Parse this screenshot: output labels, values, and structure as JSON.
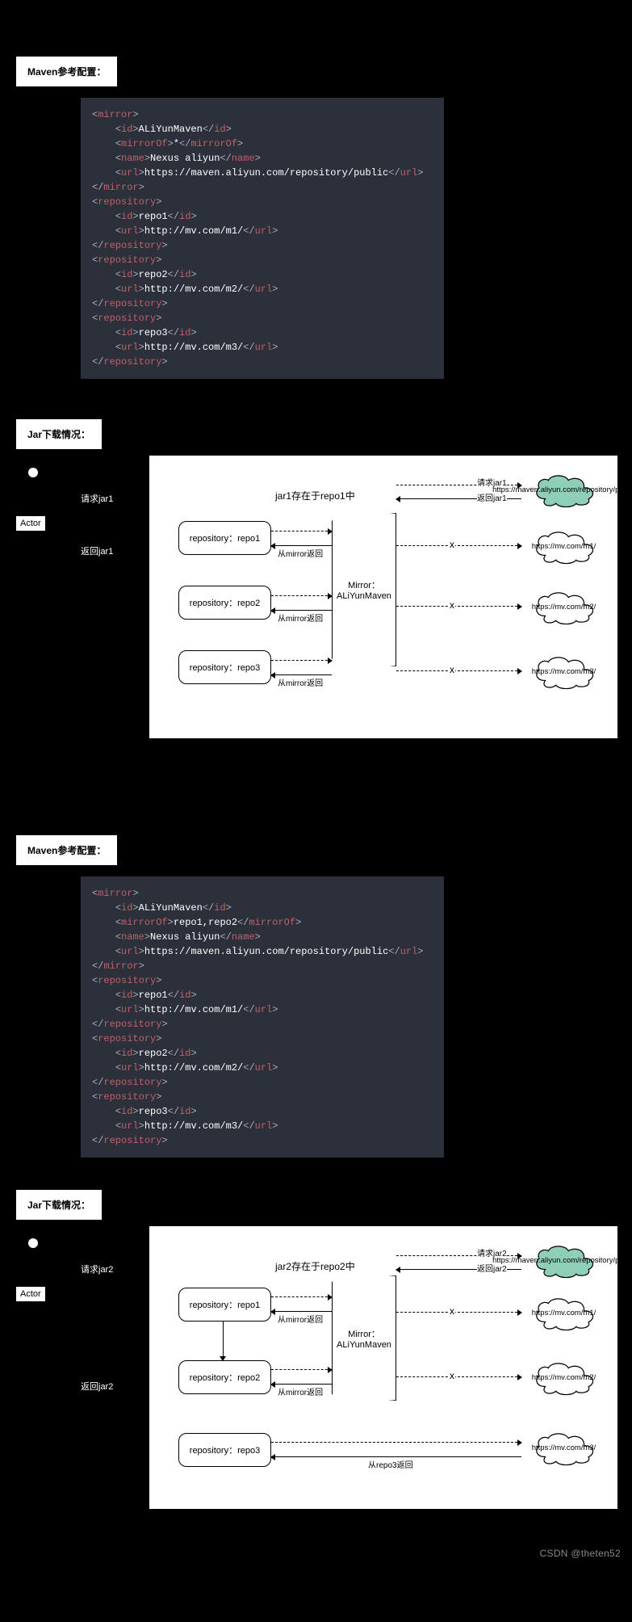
{
  "watermark": "CSDN @theten52",
  "section1": {
    "maven_label": "Maven参考配置：",
    "jar_label": "Jar下载情况：",
    "code": {
      "mirror_id": "ALiYunMaven",
      "mirror_of": "*",
      "mirror_name": "Nexus aliyun",
      "mirror_url": "https://maven.aliyun.com/repository/public",
      "repo1_id": "repo1",
      "repo1_url": "http://mv.com/m1/",
      "repo2_id": "repo2",
      "repo2_url": "http://mv.com/m2/",
      "repo3_id": "repo3",
      "repo3_url": "http://mv.com/m3/"
    },
    "diagram": {
      "actor": "Actor",
      "req": "请求jar1",
      "ret": "返回jar1",
      "title": "jar1存在于repo1中",
      "repo1": "repository：repo1",
      "repo2": "repository：repo2",
      "repo3": "repository：repo3",
      "from_mirror": "从mirror返回",
      "mirror_box_l1": "Mirror：",
      "mirror_box_l2": "ALiYunMaven",
      "ext_req": "请求jar1",
      "ext_ret": "返回jar1",
      "cloud_main": "https://maven.aliyun.com/repository/public",
      "cloud1": "https://mv.com/m1/",
      "cloud2": "https://mv.com/m2/",
      "cloud3": "https://mv.com/m3/"
    }
  },
  "section2": {
    "maven_label": "Maven参考配置：",
    "jar_label": "Jar下载情况：",
    "code": {
      "mirror_id": "ALiYunMaven",
      "mirror_of": "repo1,repo2",
      "mirror_name": "Nexus aliyun",
      "mirror_url": "https://maven.aliyun.com/repository/public",
      "repo1_id": "repo1",
      "repo1_url": "http://mv.com/m1/",
      "repo2_id": "repo2",
      "repo2_url": "http://mv.com/m2/",
      "repo3_id": "repo3",
      "repo3_url": "http://mv.com/m3/"
    },
    "diagram": {
      "actor": "Actor",
      "req": "请求jar2",
      "ret": "返回jar2",
      "title": "jar2存在于repo2中",
      "repo1": "repository：repo1",
      "repo2": "repository：repo2",
      "repo3": "repository：repo3",
      "from_mirror": "从mirror返回",
      "from_repo3": "从repo3返回",
      "mirror_box_l1": "Mirror：",
      "mirror_box_l2": "ALiYunMaven",
      "ext_req": "请求jar2",
      "ext_ret": "返回jar2",
      "cloud_main": "https://maven.aliyun.com/repository/public",
      "cloud1": "https://mv.com/m1/",
      "cloud2": "https://mv.com/m2/",
      "cloud3": "https://mv.com/m3/"
    }
  },
  "chart_data": [
    {
      "type": "diagram",
      "title": "jar1存在于repo1中 — mirrorOf=*",
      "nodes": [
        "Actor",
        "repository：repo1",
        "repository：repo2",
        "repository：repo3",
        "Mirror：ALiYunMaven",
        "https://maven.aliyun.com/repository/public",
        "https://mv.com/m1/",
        "https://mv.com/m2/",
        "https://mv.com/m3/"
      ],
      "edges": [
        {
          "from": "Actor",
          "to": "repository：repo1",
          "label": "请求jar1",
          "style": "dashed"
        },
        {
          "from": "repository：repo1",
          "to": "Actor",
          "label": "返回jar1",
          "style": "solid"
        },
        {
          "from": "repository：repo1",
          "to": "Mirror：ALiYunMaven",
          "label": "从mirror返回",
          "style": "solid-return"
        },
        {
          "from": "repository：repo2",
          "to": "Mirror：ALiYunMaven",
          "label": "从mirror返回",
          "style": "solid-return"
        },
        {
          "from": "repository：repo3",
          "to": "Mirror：ALiYunMaven",
          "label": "从mirror返回",
          "style": "solid-return"
        },
        {
          "from": "Mirror：ALiYunMaven",
          "to": "https://maven.aliyun.com/repository/public",
          "label": "请求jar1",
          "style": "dashed"
        },
        {
          "from": "https://maven.aliyun.com/repository/public",
          "to": "Mirror：ALiYunMaven",
          "label": "返回jar1",
          "style": "solid"
        },
        {
          "from": "Mirror：ALiYunMaven",
          "to": "https://mv.com/m1/",
          "blocked": true,
          "style": "dashed"
        },
        {
          "from": "Mirror：ALiYunMaven",
          "to": "https://mv.com/m2/",
          "blocked": true,
          "style": "dashed"
        },
        {
          "from": "Mirror：ALiYunMaven",
          "to": "https://mv.com/m3/",
          "blocked": true,
          "style": "dashed"
        }
      ]
    },
    {
      "type": "diagram",
      "title": "jar2存在于repo2中 — mirrorOf=repo1,repo2",
      "nodes": [
        "Actor",
        "repository：repo1",
        "repository：repo2",
        "repository：repo3",
        "Mirror：ALiYunMaven",
        "https://maven.aliyun.com/repository/public",
        "https://mv.com/m1/",
        "https://mv.com/m2/",
        "https://mv.com/m3/"
      ],
      "edges": [
        {
          "from": "Actor",
          "to": "repository：repo1",
          "label": "请求jar2",
          "style": "dashed"
        },
        {
          "from": "repository：repo1",
          "to": "repository：repo2",
          "style": "solid"
        },
        {
          "from": "repository：repo2",
          "to": "Actor",
          "label": "返回jar2",
          "style": "solid"
        },
        {
          "from": "repository：repo1",
          "to": "Mirror：ALiYunMaven",
          "label": "从mirror返回",
          "style": "solid-return"
        },
        {
          "from": "repository：repo2",
          "to": "Mirror：ALiYunMaven",
          "label": "从mirror返回",
          "style": "solid-return"
        },
        {
          "from": "repository：repo3",
          "to": "https://mv.com/m3/",
          "label": "从repo3返回",
          "style": "solid-return"
        },
        {
          "from": "Mirror：ALiYunMaven",
          "to": "https://maven.aliyun.com/repository/public",
          "label": "请求jar2",
          "style": "dashed"
        },
        {
          "from": "https://maven.aliyun.com/repository/public",
          "to": "Mirror：ALiYunMaven",
          "label": "返回jar2",
          "style": "solid"
        },
        {
          "from": "Mirror：ALiYunMaven",
          "to": "https://mv.com/m1/",
          "blocked": true,
          "style": "dashed"
        },
        {
          "from": "Mirror：ALiYunMaven",
          "to": "https://mv.com/m2/",
          "blocked": true,
          "style": "dashed"
        }
      ]
    }
  ]
}
